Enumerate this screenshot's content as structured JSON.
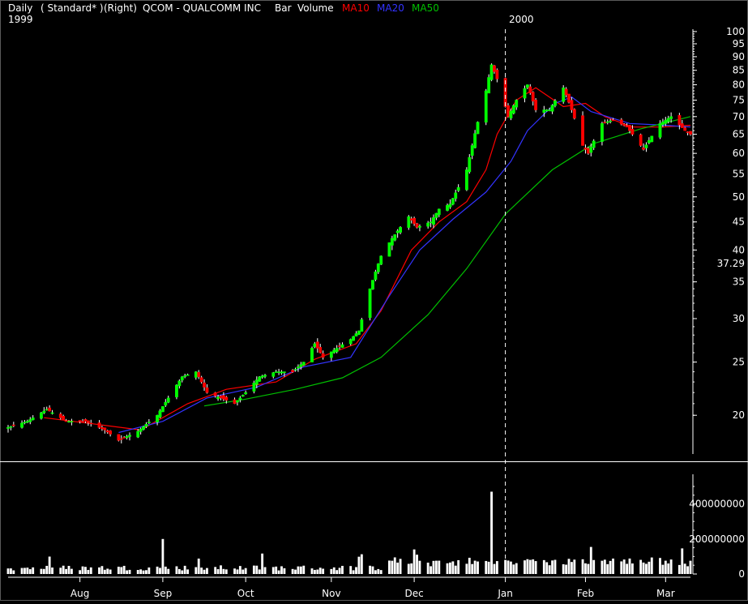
{
  "header": {
    "period": "Daily",
    "scale": "( Standard* )",
    "axis_side": "(Right)",
    "symbol": "QCOM - QUALCOMM INC",
    "style": "Bar",
    "volume": "Volume",
    "ma10": "MA10",
    "ma20": "MA20",
    "ma50": "MA50",
    "year_start": "1999",
    "year_marker": "2000"
  },
  "colors": {
    "background": "#000000",
    "axis": "#ffffff",
    "up": "#00ff00",
    "down": "#ff0000",
    "ma10": "#ff0000",
    "ma20": "#3333ff",
    "ma50": "#00c000",
    "volume": "#ffffff"
  },
  "chart_data": [
    {
      "type": "candlestick",
      "title": "QCOM - QUALCOMM INC",
      "log_scale": true,
      "ylim": [
        17,
        101
      ],
      "yticks": [
        20,
        25,
        30,
        35,
        40,
        45,
        50,
        55,
        60,
        65,
        70,
        75,
        80,
        85,
        90,
        95,
        100
      ],
      "last_price_label": "37.29",
      "x_labels": [
        {
          "label": "Aug",
          "date": "1999-08-02"
        },
        {
          "label": "Sep",
          "date": "1999-09-01"
        },
        {
          "label": "Oct",
          "date": "1999-10-01"
        },
        {
          "label": "Nov",
          "date": "1999-11-01"
        },
        {
          "label": "Dec",
          "date": "1999-12-01"
        },
        {
          "label": "Jan",
          "date": "2000-01-03"
        },
        {
          "label": "Feb",
          "date": "2000-02-01"
        },
        {
          "label": "Mar",
          "date": "2000-03-01"
        }
      ],
      "x_range": [
        "1999-07-07",
        "2000-03-10"
      ],
      "year_divider": "2000-01-03",
      "series_legend": [
        "MA10",
        "MA20",
        "MA50"
      ],
      "close_series": [
        [
          "1999-07-07",
          19.0
        ],
        [
          "1999-07-14",
          19.5
        ],
        [
          "1999-07-21",
          20.5
        ],
        [
          "1999-07-28",
          19.5
        ],
        [
          "1999-08-04",
          19.5
        ],
        [
          "1999-08-11",
          18.8
        ],
        [
          "1999-08-16",
          18.0
        ],
        [
          "1999-08-23",
          18.7
        ],
        [
          "1999-08-30",
          20.0
        ],
        [
          "1999-09-03",
          21.5
        ],
        [
          "1999-09-08",
          23.5
        ],
        [
          "1999-09-13",
          24.0
        ],
        [
          "1999-09-17",
          22.0
        ],
        [
          "1999-09-22",
          21.5
        ],
        [
          "1999-09-27",
          21.0
        ],
        [
          "1999-10-01",
          22.0
        ],
        [
          "1999-10-06",
          23.5
        ],
        [
          "1999-10-12",
          24.0
        ],
        [
          "1999-10-18",
          24.0
        ],
        [
          "1999-10-22",
          25.0
        ],
        [
          "1999-10-26",
          27.0
        ],
        [
          "1999-10-29",
          25.5
        ],
        [
          "1999-11-03",
          26.5
        ],
        [
          "1999-11-08",
          27.5
        ],
        [
          "1999-11-11",
          28.5
        ],
        [
          "1999-11-15",
          34.0
        ],
        [
          "1999-11-19",
          39.0
        ],
        [
          "1999-11-23",
          42.0
        ],
        [
          "1999-11-29",
          46.0
        ],
        [
          "1999-12-02",
          44.0
        ],
        [
          "1999-12-07",
          45.0
        ],
        [
          "1999-12-10",
          47.5
        ],
        [
          "1999-12-14",
          48.5
        ],
        [
          "1999-12-17",
          52.0
        ],
        [
          "1999-12-20",
          56.0
        ],
        [
          "1999-12-22",
          62.0
        ],
        [
          "1999-12-27",
          78.0
        ],
        [
          "1999-12-29",
          87.0
        ],
        [
          "1999-12-31",
          82.0
        ],
        [
          "2000-01-04",
          70.0
        ],
        [
          "2000-01-07",
          75.0
        ],
        [
          "2000-01-11",
          80.0
        ],
        [
          "2000-01-14",
          72.0
        ],
        [
          "2000-01-19",
          72.0
        ],
        [
          "2000-01-24",
          79.0
        ],
        [
          "2000-01-27",
          72.0
        ],
        [
          "2000-01-31",
          62.0
        ],
        [
          "2000-02-02",
          60.0
        ],
        [
          "2000-02-07",
          68.0
        ],
        [
          "2000-02-11",
          69.0
        ],
        [
          "2000-02-16",
          67.0
        ],
        [
          "2000-02-22",
          61.0
        ],
        [
          "2000-02-28",
          68.0
        ],
        [
          "2000-03-03",
          70.0
        ],
        [
          "2000-03-08",
          66.0
        ],
        [
          "2000-03-10",
          65.0
        ]
      ],
      "ma_series": [
        {
          "name": "MA10",
          "color": "#ff0000",
          "points": [
            [
              "1999-07-20",
              19.8
            ],
            [
              "1999-08-10",
              19.2
            ],
            [
              "1999-08-24",
              18.8
            ],
            [
              "1999-09-10",
              21.0
            ],
            [
              "1999-09-24",
              22.3
            ],
            [
              "1999-10-12",
              23.0
            ],
            [
              "1999-10-26",
              25.3
            ],
            [
              "1999-11-10",
              27.0
            ],
            [
              "1999-11-19",
              31.0
            ],
            [
              "1999-11-30",
              40.0
            ],
            [
              "1999-12-10",
              45.0
            ],
            [
              "1999-12-20",
              49.0
            ],
            [
              "1999-12-27",
              56.0
            ],
            [
              "1999-12-31",
              65.0
            ],
            [
              "2000-01-07",
              75.0
            ],
            [
              "2000-01-14",
              79.0
            ],
            [
              "2000-01-24",
              73.0
            ],
            [
              "2000-02-01",
              74.0
            ],
            [
              "2000-02-08",
              70.0
            ],
            [
              "2000-02-18",
              67.0
            ],
            [
              "2000-02-29",
              67.0
            ],
            [
              "2000-03-10",
              67.5
            ]
          ]
        },
        {
          "name": "MA20",
          "color": "#3333ff",
          "points": [
            [
              "1999-08-16",
              18.6
            ],
            [
              "1999-09-01",
              19.5
            ],
            [
              "1999-09-17",
              21.5
            ],
            [
              "1999-10-05",
              22.5
            ],
            [
              "1999-10-22",
              24.5
            ],
            [
              "1999-11-08",
              25.5
            ],
            [
              "1999-11-22",
              33.0
            ],
            [
              "1999-12-03",
              40.0
            ],
            [
              "1999-12-15",
              45.5
            ],
            [
              "1999-12-27",
              51.0
            ],
            [
              "2000-01-05",
              58.0
            ],
            [
              "2000-01-11",
              66.0
            ],
            [
              "2000-01-21",
              74.0
            ],
            [
              "2000-01-27",
              76.0
            ],
            [
              "2000-02-03",
              71.5
            ],
            [
              "2000-02-17",
              68.0
            ],
            [
              "2000-03-01",
              67.5
            ],
            [
              "2000-03-10",
              67.0
            ]
          ]
        },
        {
          "name": "MA50",
          "color": "#00c000",
          "points": [
            [
              "1999-09-16",
              20.8
            ],
            [
              "1999-10-01",
              21.4
            ],
            [
              "1999-10-19",
              22.3
            ],
            [
              "1999-11-05",
              23.4
            ],
            [
              "1999-11-19",
              25.5
            ],
            [
              "1999-12-06",
              30.5
            ],
            [
              "1999-12-20",
              37.0
            ],
            [
              "2000-01-03",
              46.5
            ],
            [
              "2000-01-20",
              56.0
            ],
            [
              "2000-02-04",
              62.5
            ],
            [
              "2000-02-21",
              66.5
            ],
            [
              "2000-03-10",
              70.0
            ]
          ]
        }
      ]
    },
    {
      "type": "bar",
      "title": "Volume",
      "ylim": [
        0,
        500000000
      ],
      "yticks": [
        0,
        200000000,
        400000000
      ],
      "ytick_labels": [
        "0",
        "200000000",
        "400000000"
      ],
      "spikes": [
        {
          "date": "1999-09-01",
          "value": 200000000
        },
        {
          "date": "1999-12-29",
          "value": 470000000
        }
      ]
    }
  ]
}
